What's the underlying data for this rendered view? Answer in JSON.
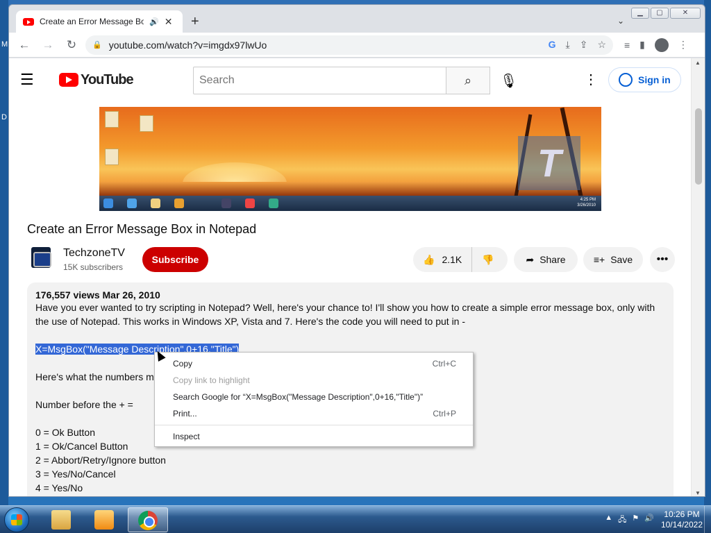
{
  "desktop": {
    "left_letters": [
      "M",
      "D"
    ]
  },
  "browser": {
    "tab": {
      "title": "Create an Error Message Box",
      "audio_icon": "speaker-icon"
    },
    "new_tab_label": "+",
    "url": "youtube.com/watch?v=imgdx97lwUo",
    "window_controls": {
      "minimize": "▁",
      "maximize": "▢",
      "close": "✕"
    }
  },
  "youtube": {
    "logo_text": "YouTube",
    "search": {
      "placeholder": "Search"
    },
    "sign_in_label": "Sign in",
    "video_title": "Create an Error Message Box in Notepad",
    "channel": {
      "name": "TechzoneTV",
      "subscribers": "15K subscribers"
    },
    "subscribe_label": "Subscribe",
    "like_count": "2.1K",
    "share_label": "Share",
    "save_label": "Save",
    "description": {
      "meta": "176,557 views  Mar 26, 2010",
      "intro": "Have you ever wanted to try scripting in Notepad? Well, here's your chance to! I'll show you how to create a simple error message box, only with the use of Notepad. This works in Windows XP, Vista and 7. Here's the code you will need to put in -",
      "code": "X=MsgBox(\"Message Description\",0+16,\"Title\")",
      "numbers_line": "Here's what the numbers me",
      "before_plus": "Number before the + =",
      "options": [
        "0 = Ok Button",
        "1 = Ok/Cancel Button",
        "2 = Abbort/Retry/Ignore button",
        "3 = Yes/No/Cancel",
        "4 = Yes/No"
      ]
    },
    "video_thumbnail_time": {
      "time": "4:25 PM",
      "date": "3/26/2010"
    }
  },
  "context_menu": {
    "items": [
      {
        "label": "Copy",
        "shortcut": "Ctrl+C",
        "enabled": true
      },
      {
        "label": "Copy link to highlight",
        "shortcut": "",
        "enabled": false
      },
      {
        "label": "Search Google for “X=MsgBox(\"Message Description\",0+16,\"Title\")”",
        "shortcut": "",
        "enabled": true
      },
      {
        "label": "Print...",
        "shortcut": "Ctrl+P",
        "enabled": true
      },
      {
        "label": "Inspect",
        "shortcut": "",
        "enabled": true
      }
    ]
  },
  "taskbar": {
    "time": "10:26 PM",
    "date": "10/14/2022"
  },
  "colors": {
    "youtube_red": "#ff0000",
    "subscribe_red": "#cc0000",
    "selection_blue": "#3367d6",
    "link_blue": "#065fd4"
  }
}
